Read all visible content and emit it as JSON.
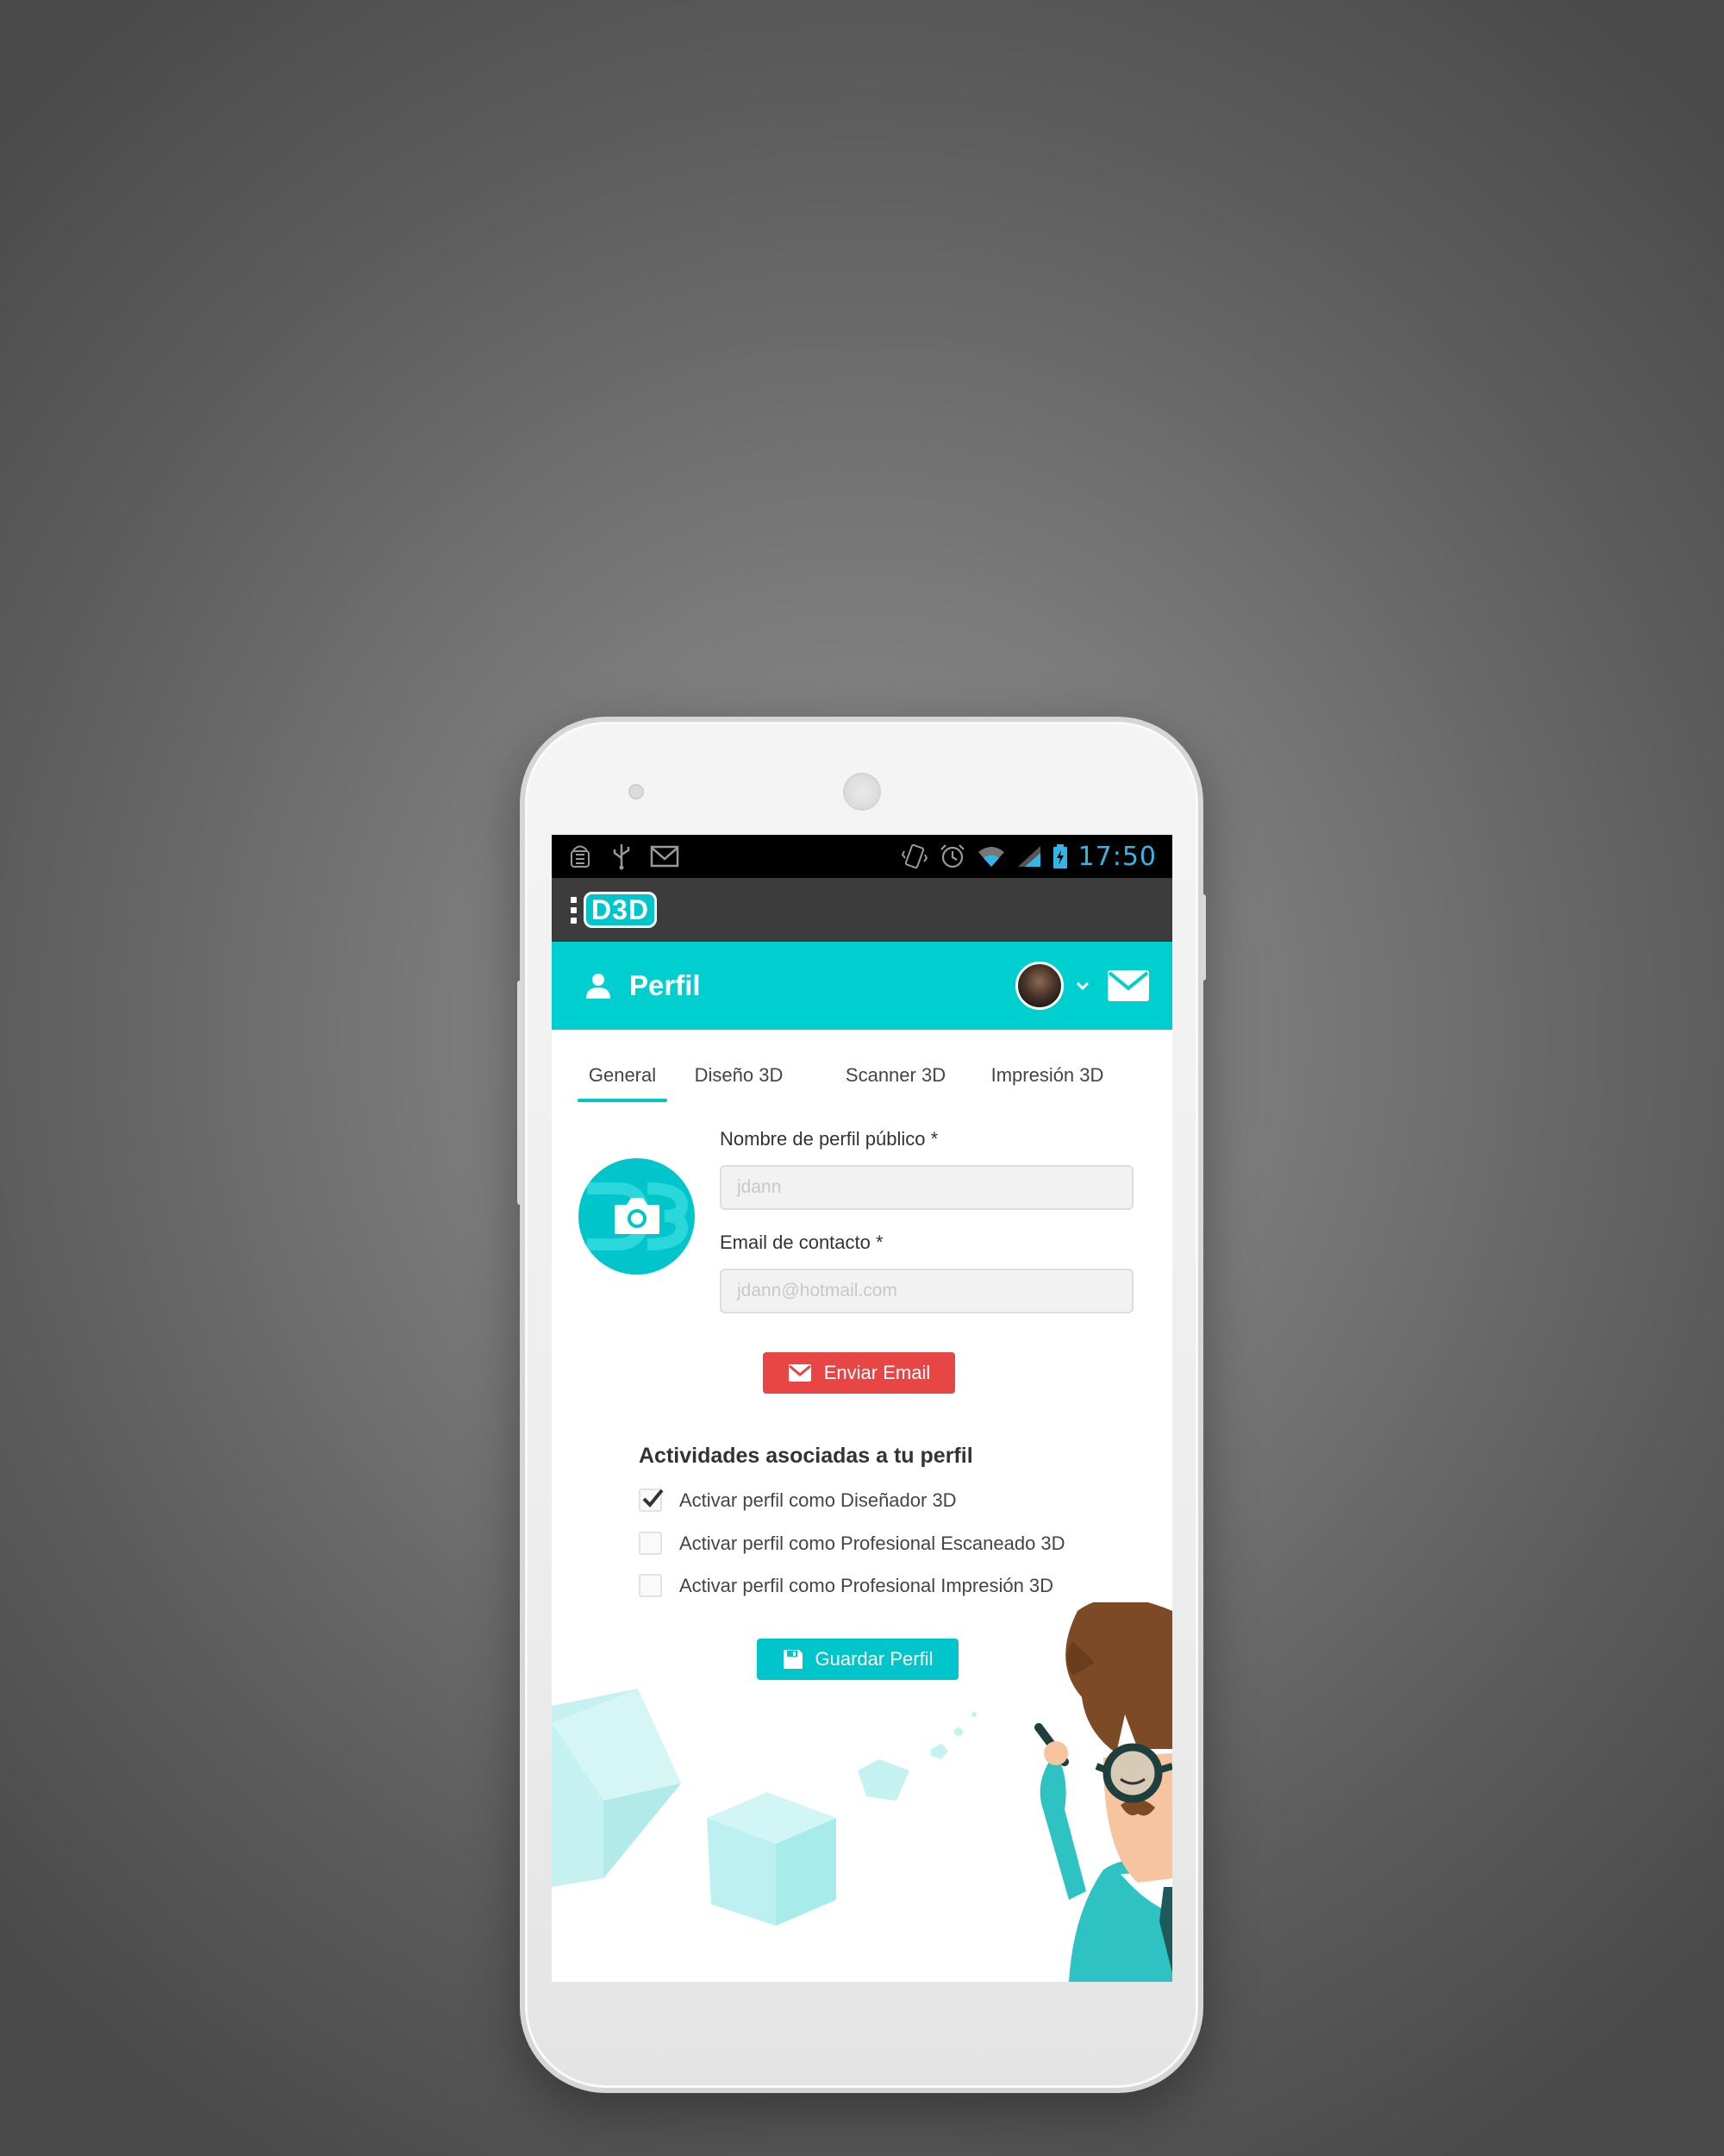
{
  "status_bar": {
    "time": "17:50",
    "icons_left": [
      "android-debug-icon",
      "usb-icon",
      "gmail-icon"
    ],
    "icons_right": [
      "vibrate-icon",
      "alarm-icon",
      "wifi-icon",
      "signal-icon",
      "battery-charging-icon"
    ],
    "time_color": "#33b5e5"
  },
  "app_bar": {
    "logo_text": "D3D",
    "menu_icon": "overflow-menu-icon"
  },
  "header": {
    "title": "Perfil",
    "icon": "user-icon",
    "avatar_icon": "user-avatar",
    "dropdown_icon": "chevron-down-icon",
    "mail_icon": "envelope-icon",
    "color": "#00cfcf"
  },
  "tabs": [
    {
      "label": "General",
      "active": true
    },
    {
      "label": "Diseño 3D",
      "active": false
    },
    {
      "label": "Scanner 3D",
      "active": false
    },
    {
      "label": "Impresión 3D",
      "active": false
    }
  ],
  "form": {
    "photo_icon": "camera-icon",
    "name_label": "Nombre de perfil público *",
    "name_placeholder": "jdann",
    "email_label": "Email de contacto *",
    "email_placeholder": "jdann@hotmail.com",
    "send_email_button": "Enviar Email",
    "send_email_color": "#e84545"
  },
  "activities": {
    "title": "Actividades asociadas a tu perfil",
    "items": [
      {
        "label": "Activar perfil como Diseñador 3D",
        "checked": true
      },
      {
        "label": "Activar perfil como Profesional Escaneado 3D",
        "checked": false
      },
      {
        "label": "Activar perfil como Profesional Impresión 3D",
        "checked": false
      }
    ]
  },
  "save_button": "Guardar Perfil",
  "accent_color": "#00c6cb"
}
